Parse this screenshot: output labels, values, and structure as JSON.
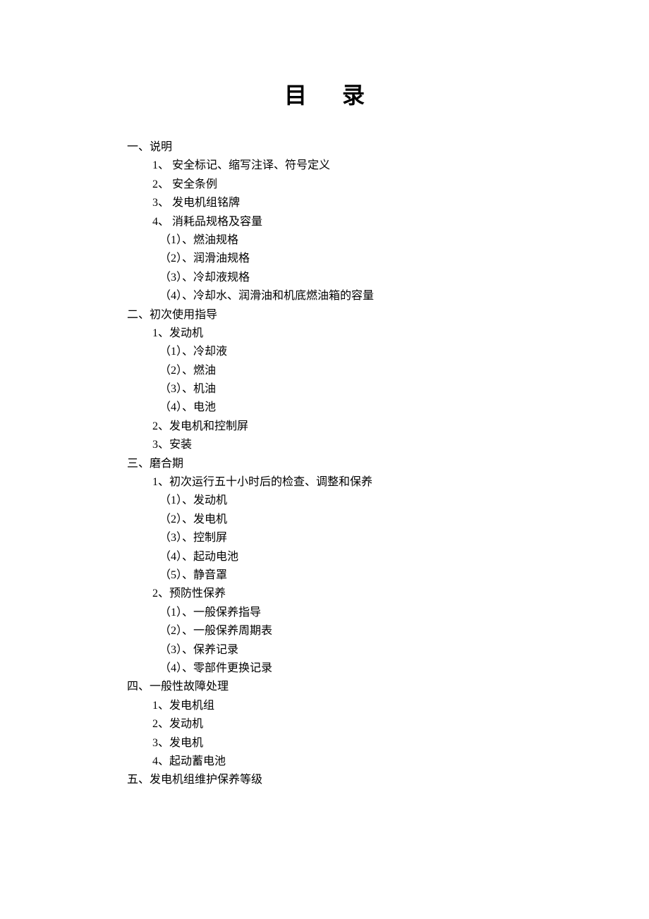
{
  "title": "目录",
  "toc": {
    "sections": [
      {
        "label": "一、说明",
        "children": [
          {
            "label": "1、 安全标记、缩写注译、符号定义"
          },
          {
            "label": "2、 安全条例"
          },
          {
            "label": "3、 发电机组铭牌"
          },
          {
            "label": "4、 消耗品规格及容量",
            "children": [
              {
                "label": "（1）、燃油规格"
              },
              {
                "label": "（2）、润滑油规格"
              },
              {
                "label": "（3）、冷却液规格"
              },
              {
                "label": "（4）、冷却水、润滑油和机底燃油箱的容量"
              }
            ]
          }
        ]
      },
      {
        "label": "二、初次使用指导",
        "children": [
          {
            "label": "1、发动机",
            "children": [
              {
                "label": "（1）、冷却液"
              },
              {
                "label": "（2）、燃油"
              },
              {
                "label": "（3）、机油"
              },
              {
                "label": "（4）、电池"
              }
            ]
          },
          {
            "label": "2、发电机和控制屏"
          },
          {
            "label": "3、安装"
          }
        ]
      },
      {
        "label": "三、磨合期",
        "children": [
          {
            "label": "1、初次运行五十小时后的检查、调整和保养",
            "children": [
              {
                "label": "（1）、发动机"
              },
              {
                "label": "（2）、发电机"
              },
              {
                "label": "（3）、控制屏"
              },
              {
                "label": "（4）、起动电池"
              },
              {
                "label": "（5）、静音罩"
              }
            ]
          },
          {
            "label": "2、预防性保养",
            "children": [
              {
                "label": "（1）、一般保养指导"
              },
              {
                "label": "（2）、一般保养周期表"
              },
              {
                "label": "（3）、保养记录"
              },
              {
                "label": "（4）、零部件更换记录"
              }
            ]
          }
        ]
      },
      {
        "label": "四、一般性故障处理",
        "children": [
          {
            "label": "1、发电机组"
          },
          {
            "label": "2、发动机"
          },
          {
            "label": "3、发电机"
          },
          {
            "label": "4、起动蓄电池"
          }
        ]
      },
      {
        "label": "五、发电机组维护保养等级"
      }
    ]
  }
}
